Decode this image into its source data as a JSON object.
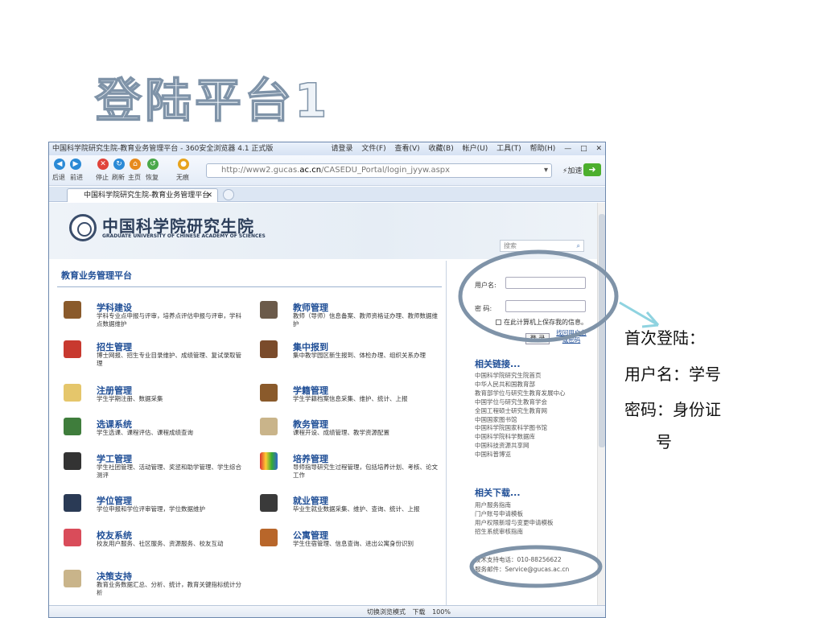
{
  "slide": {
    "title": "登陆平台1",
    "note_lines": [
      "首次登陆：",
      "用户名：学号",
      "密码：身份证",
      "号"
    ]
  },
  "browser": {
    "window_title": "中国科学院研究生院-教育业务管理平台 - 360安全浏览器 4.1 正式版",
    "menu": [
      "请登录",
      "文件(F)",
      "查看(V)",
      "收藏(B)",
      "帐户(U)",
      "工具(T)",
      "帮助(H)"
    ],
    "nav_labels": [
      "后退",
      "前进",
      "停止",
      "刷新",
      "主页",
      "恢复",
      "无痕"
    ],
    "url_prefix": "http://www2.gucas.",
    "url_domain": "ac.cn",
    "url_path": "/CASEDU_Portal/login_jyyw.aspx",
    "accelerate": "加速",
    "tab_title": "中国科学院研究生院-教育业务管理平台",
    "status_items": [
      "切换浏览模式",
      "下载",
      "100%"
    ]
  },
  "page": {
    "logo_cn": "中国科学院研究生院",
    "logo_en": "GRADUATE UNIVERSITY OF CHINESE ACADEMY OF SCIENCES",
    "search_placeholder": "搜索",
    "section_title": "教育业务管理平台",
    "modules_left": [
      {
        "title": "学科建设",
        "desc": "学科专业点申报与评审，培养点评估申报与评审，学科点数据维护"
      },
      {
        "title": "招生管理",
        "desc": "博士网报、招生专业目录维护、成绩管理、复试录取管理"
      },
      {
        "title": "注册管理",
        "desc": "学生学期注册、数据采集"
      },
      {
        "title": "选课系统",
        "desc": "学生选课、课程评估、课程成绩查询"
      },
      {
        "title": "学工管理",
        "desc": "学生社团管理、活动管理、奖惩和助学管理、学生综合测评"
      },
      {
        "title": "学位管理",
        "desc": "学位申报和学位评审管理，学位数据维护"
      },
      {
        "title": "校友系统",
        "desc": "校友用户服务、社区服务、资源服务、校友互动"
      },
      {
        "title": "决策支持",
        "desc": "教育业务数据汇总、分析、统计，教育关键指标统计分析"
      }
    ],
    "modules_right": [
      {
        "title": "教师管理",
        "desc": "教师（导师）信息备案、教师资格证办理、教师数据维护"
      },
      {
        "title": "集中报到",
        "desc": "集中教学园区新生报到、体检办理、组织关系办理"
      },
      {
        "title": "学籍管理",
        "desc": "学生学籍档案信息采集、维护、统计、上报"
      },
      {
        "title": "教务管理",
        "desc": "课程开设、成绩管理、教学资源配置"
      },
      {
        "title": "培养管理",
        "desc": "导师指导研究生过程管理，包括培养计划、考核、论文工作"
      },
      {
        "title": "就业管理",
        "desc": "毕业生就业数据采集、维护、查询、统计、上报"
      },
      {
        "title": "公寓管理",
        "desc": "学生住宿管理、信息查询、进出公寓身份识别"
      }
    ],
    "login": {
      "username_label": "用户名:",
      "password_label": "密  码:",
      "remember_label": "在此计算机上保存我的信息。",
      "login_button": "登 录",
      "forgot_link": "找回用户名或密码"
    },
    "related_links_title": "相关链接...",
    "related_links": [
      "中国科学院研究生院首页",
      "中华人民共和国教育部",
      "教育部学位与研究生教育发展中心",
      "中国学位与研究生教育学会",
      "全国工程硕士研究生教育网",
      "中国国家图书馆",
      "中国科学院国家科学图书馆",
      "中国科学院科学数据库",
      "中国科技资源共享网",
      "中国科普博览"
    ],
    "downloads_title": "相关下载...",
    "downloads": [
      "用户服务指南",
      "门户账号申请模板",
      "用户权限新增与变更申请模板",
      "招生系统审核指南"
    ],
    "support_phone": "技术支持电话：010-88256622",
    "support_email": "服务邮件：Service@gucas.ac.cn"
  },
  "colors": {
    "link": "#1f4e96",
    "annotation_ellipse": "#7f93a8",
    "arrow": "#8fd3e0"
  }
}
